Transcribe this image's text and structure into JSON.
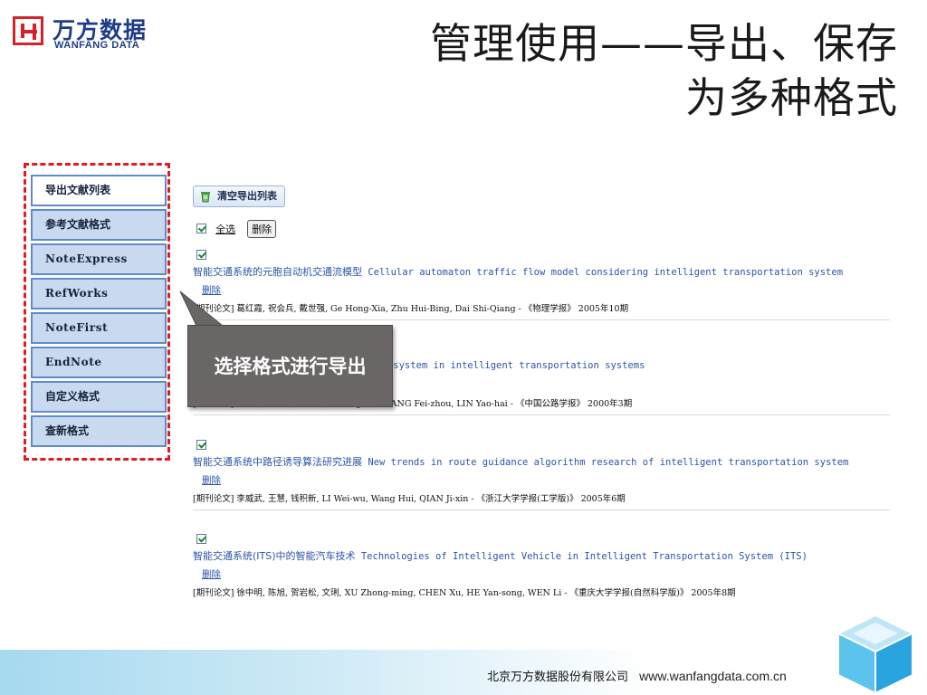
{
  "logo": {
    "cn": "万方数据",
    "en": "WANFANG DATA"
  },
  "slide_title": {
    "line1": "管理使用——导出、保存",
    "line2": "为多种格式"
  },
  "menu": {
    "items": [
      {
        "label": "导出文献列表",
        "active": true
      },
      {
        "label": "参考文献格式",
        "active": false
      },
      {
        "label": "NoteExpress",
        "active": false
      },
      {
        "label": "RefWorks",
        "active": false
      },
      {
        "label": "NoteFirst",
        "active": false
      },
      {
        "label": "EndNote",
        "active": false
      },
      {
        "label": "自定义格式",
        "active": false
      },
      {
        "label": "查新格式",
        "active": false
      }
    ]
  },
  "callout": {
    "text": "选择格式进行导出"
  },
  "toolbar": {
    "clear_label": "清空导出列表"
  },
  "select_all": {
    "label": "全选",
    "checked": true,
    "delete_label": "删除"
  },
  "records": [
    {
      "checked": true,
      "title_cn": "智能交通系统的元胞自动机交通流模型",
      "title_en": "Cellular automaton traffic flow model considering intelligent transportation system",
      "delete_label": "删除",
      "meta": "[期刊论文] 葛红霞, 祝会兵, 戴世强, Ge Hong-Xia, Zhu Hui-Bing, Dai Shi-Qiang - 《物理学报》 2005年10期"
    },
    {
      "checked": true,
      "title_cn": "",
      "title_en": "Research on geographic information system in intelligent transportation systems",
      "delete_label": "删除",
      "meta": "[期刊论文] 李英姿, 张飞舟, 林耀海, LI Ying-zi, ZHANG Fei-zhou, LIN Yao-hai - 《中国公路学报》 2000年3期"
    },
    {
      "checked": true,
      "title_cn": "智能交通系统中路径诱导算法研究进展",
      "title_en": "New trends in route guidance algorithm research of intelligent transportation system",
      "delete_label": "删除",
      "meta": "[期刊论文] 李威武, 王慧, 钱积新, LI Wei-wu, Wang Hui, QIAN Ji-xin - 《浙江大学学报(工学版)》 2005年6期"
    },
    {
      "checked": true,
      "title_cn": "智能交通系统(ITS)中的智能汽车技术",
      "title_en": "Technologies of Intelligent Vehicle in Intelligent Transportation System (ITS)",
      "delete_label": "删除",
      "meta": "[期刊论文] 徐中明, 陈旭, 贺岩松, 文琍, XU Zhong-ming, CHEN Xu, HE Yan-song, WEN Li - 《重庆大学学报(自然科学版)》 2005年8期"
    }
  ],
  "footer": {
    "company": "北京万方数据股份有限公司",
    "url": "www.wanfangdata.com.cn"
  },
  "colors": {
    "accent_red": "#e01b24",
    "link_blue": "#2b55a8",
    "menu_bg": "#c9d9f0",
    "callout_bg": "#6a6665"
  }
}
